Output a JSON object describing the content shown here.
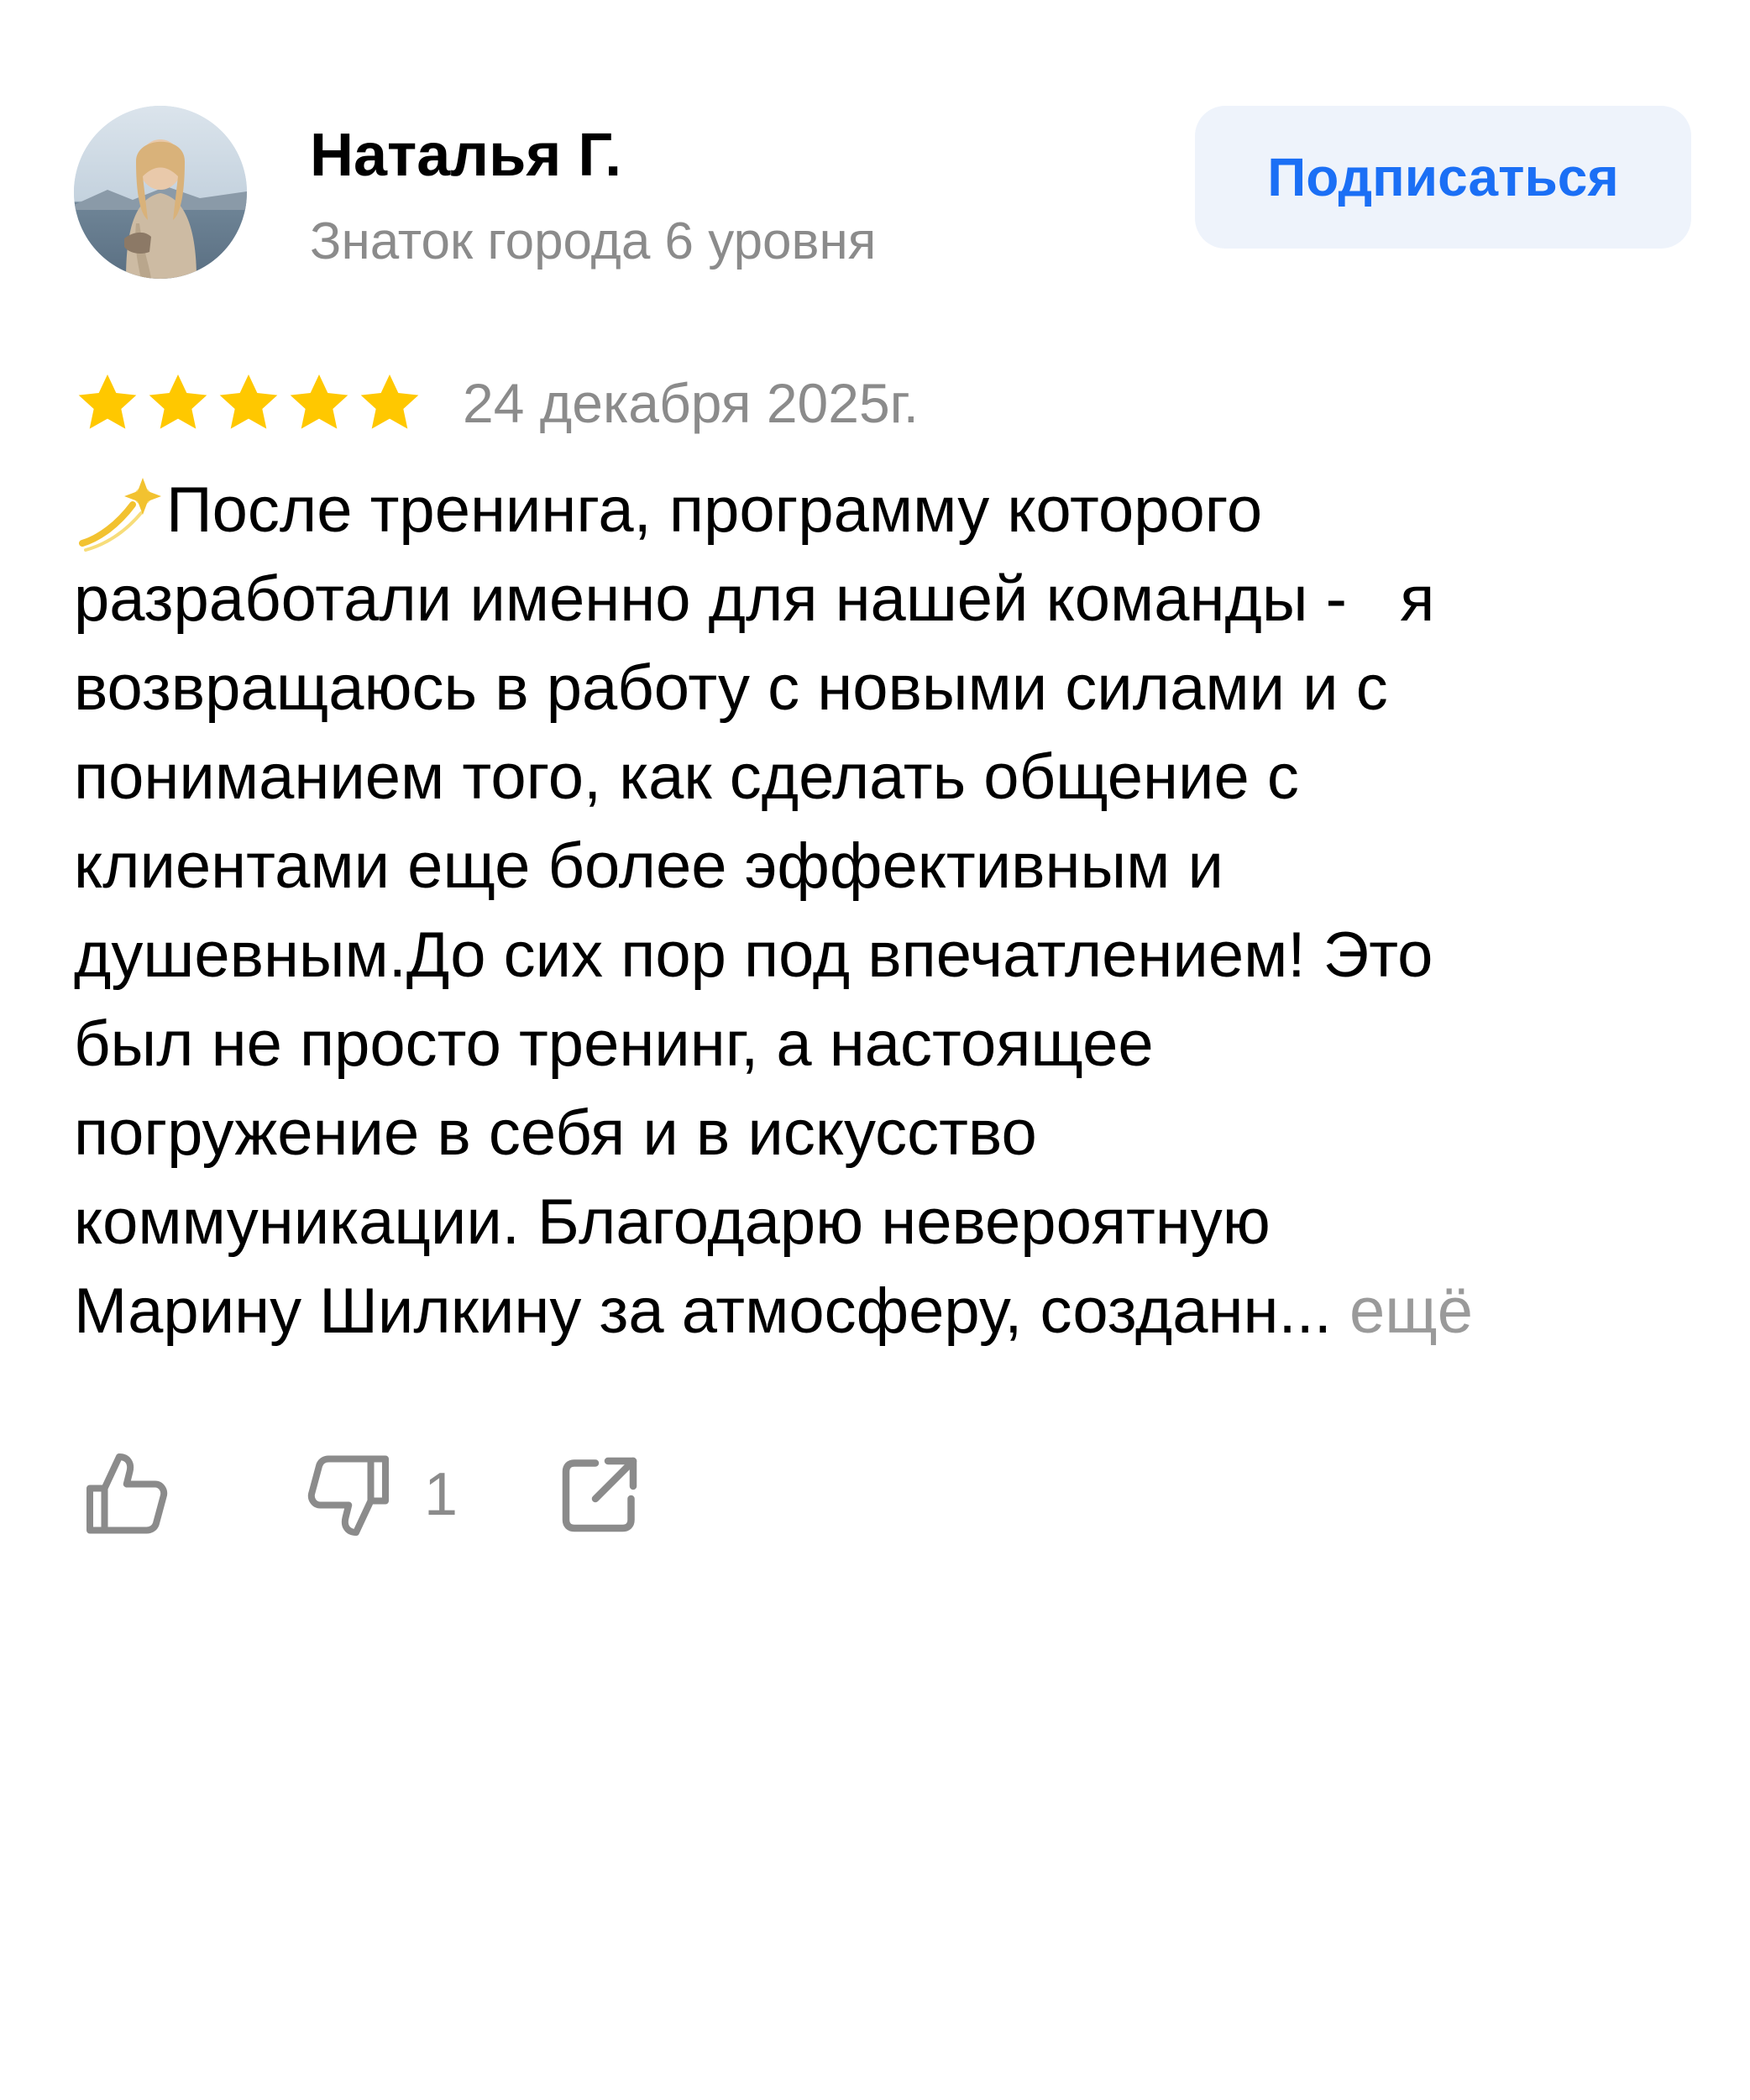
{
  "author": {
    "name": "Наталья Г.",
    "level": "Знаток города 6 уровня",
    "avatar_icon": "user-photo"
  },
  "subscribe": {
    "label": "Подписаться",
    "color": "#1b6ff5",
    "background": "#eef3fb"
  },
  "rating": {
    "stars": 5,
    "max": 5,
    "star_color": "#ffc800",
    "icon": "star-icon"
  },
  "review": {
    "date": "24 декабря 2025г.",
    "emoji": "dizzy-emoji",
    "lines": [
      "После тренинга, программу которого",
      "разработали именно для нашей команды -   я",
      "возвращаюсь в работу с новыми силами и с",
      "пониманием того, как сделать общение с",
      "клиентами еще более эффективным и",
      "душевным.До сих пор под впечатлением! Это",
      "был не просто тренинг, а настоящее",
      "погружение в себя и в искусство",
      "коммуникации. Благодарю невероятную",
      "Марину Шилкину за атмосферу, созданн..."
    ],
    "more_label": "ещё"
  },
  "actions": {
    "like_icon": "thumbs-up-icon",
    "dislike_icon": "thumbs-down-icon",
    "dislike_count": "1",
    "share_icon": "share-icon"
  }
}
